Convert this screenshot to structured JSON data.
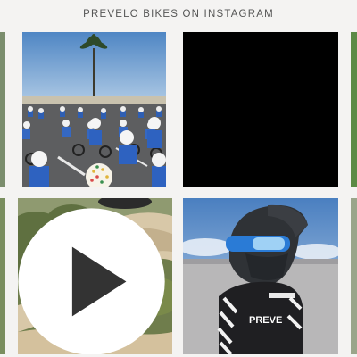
{
  "feed": {
    "title": "PREVELO BIKES ON INSTAGRAM"
  },
  "posts": [
    {
      "id": "post-1",
      "alt_icon": "photo",
      "scene": "kids-on-bikes-race"
    },
    {
      "id": "post-2",
      "alt_icon": "photo",
      "scene": "black-image"
    },
    {
      "id": "post-3",
      "alt_icon": "video-play-icon",
      "scene": "dirt-trail-rider"
    },
    {
      "id": "post-4",
      "alt_icon": "photo",
      "scene": "helmet-kid",
      "shirt_text": "PREVE"
    }
  ],
  "colors": {
    "background": "#f4f3f2",
    "title_text": "#555555"
  }
}
